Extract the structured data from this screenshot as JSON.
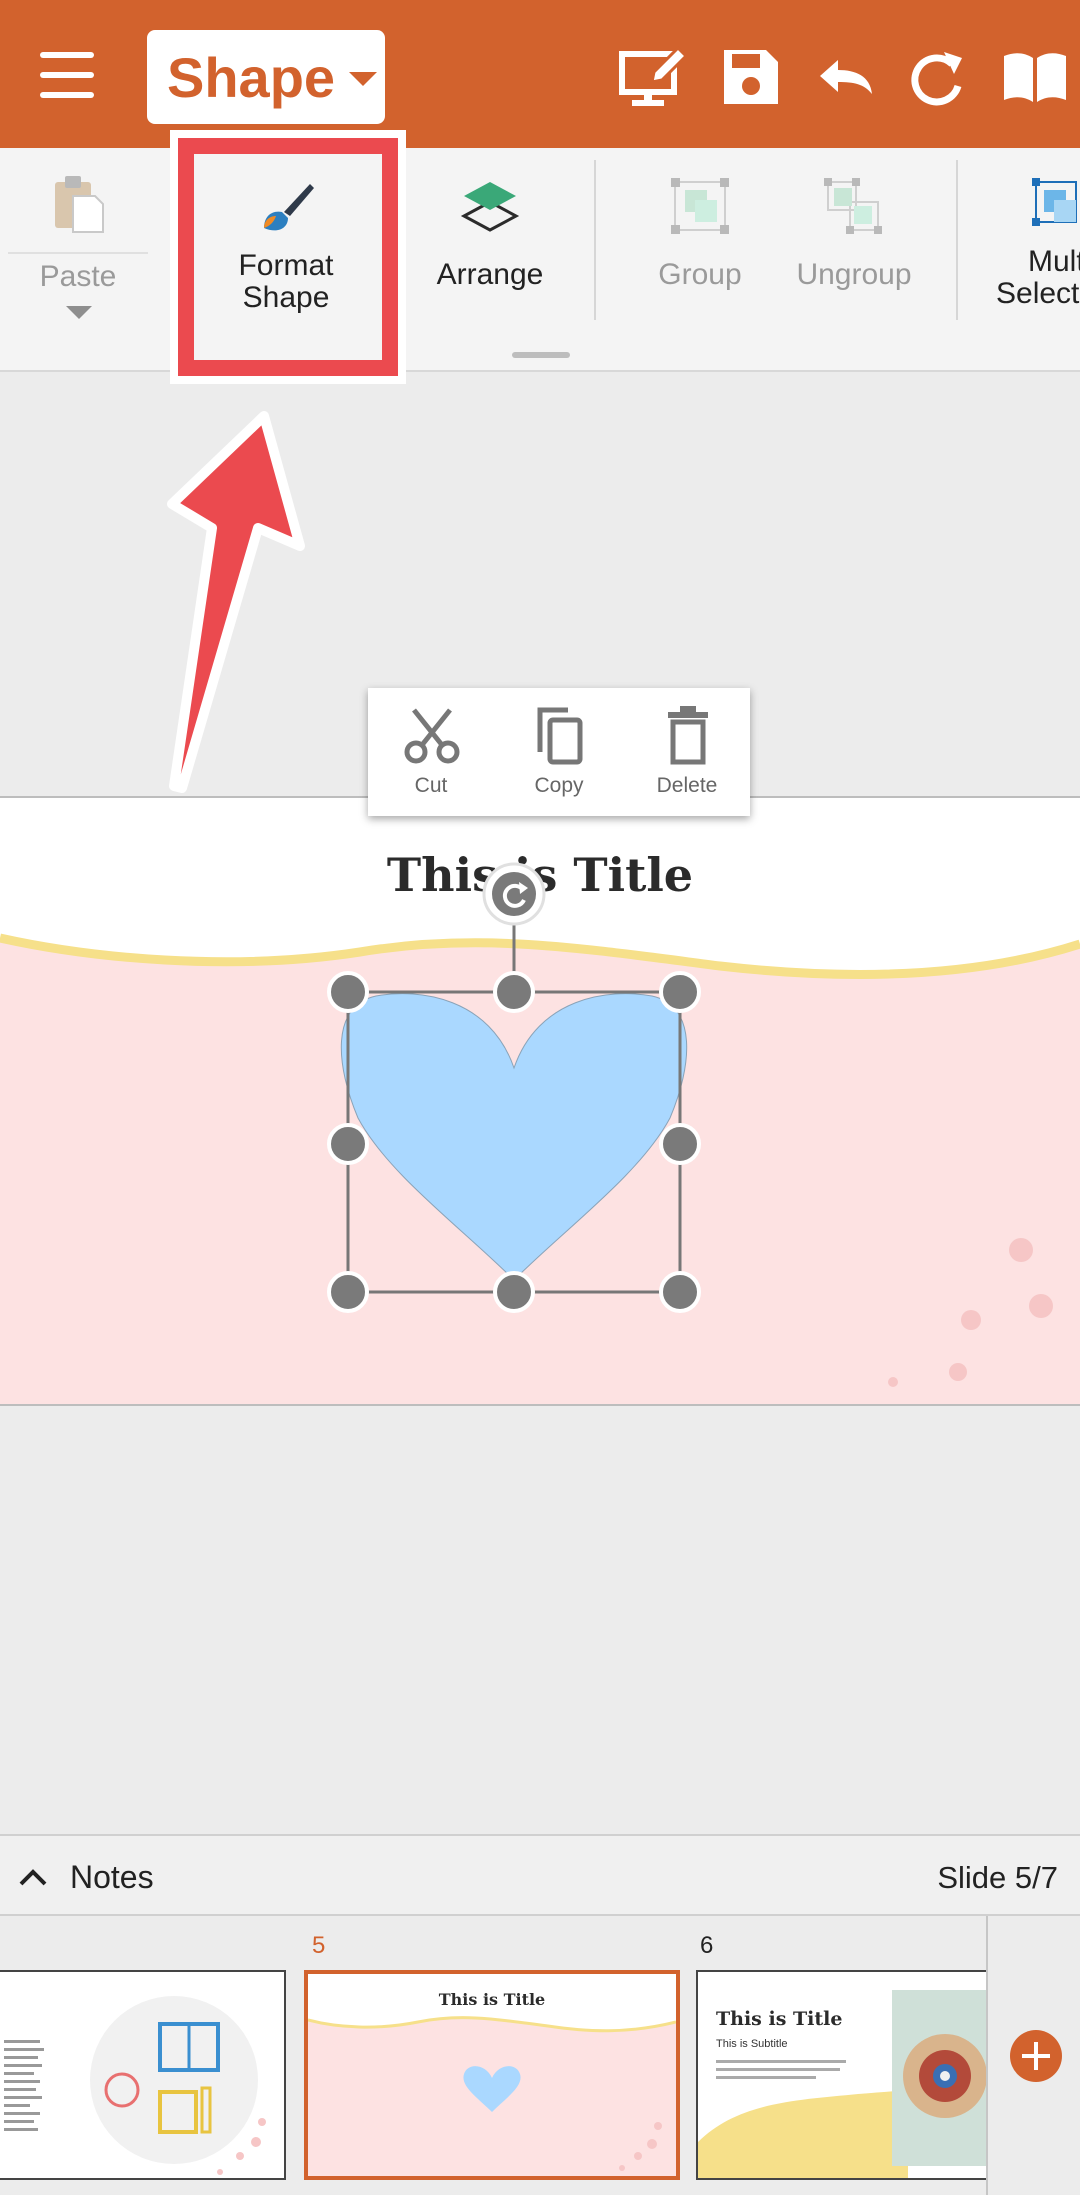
{
  "toolbar": {
    "mode_label": "Shape",
    "icons": [
      "menu-icon",
      "presentation-edit-icon",
      "save-icon",
      "undo-icon",
      "redo-icon",
      "book-icon"
    ]
  },
  "ribbon": {
    "paste": "Paste",
    "format_shape_line1": "Format",
    "format_shape_line2": "Shape",
    "arrange": "Arrange",
    "group": "Group",
    "ungroup": "Ungroup",
    "multi_select_line1": "Mult",
    "multi_select_line2": "Select"
  },
  "context_menu": {
    "cut": "Cut",
    "copy": "Copy",
    "delete": "Delete"
  },
  "slide": {
    "title": "This is Title"
  },
  "notes": {
    "label": "Notes",
    "slide_counter": "Slide 5/7"
  },
  "thumbnails": {
    "current_num": "5",
    "next_num": "6",
    "current_title": "This is Title",
    "next_title": "This is Title",
    "next_subtitle": "This is Subtitle"
  },
  "colors": {
    "brand": "#d2622d",
    "highlight": "#eb4a4f",
    "heart": "#aad8ff",
    "slide_bg": "#fde2e2",
    "wave": "#f6e08a"
  }
}
